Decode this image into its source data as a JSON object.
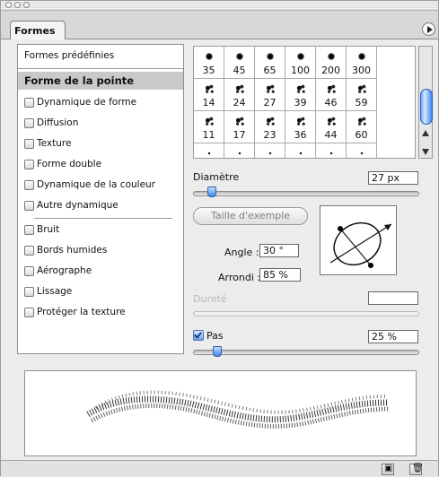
{
  "window": {
    "title": ""
  },
  "tabs": [
    {
      "label": "Formes"
    }
  ],
  "leftPanel": {
    "presets": "Formes prédéfinies",
    "header": "Forme de la pointe",
    "items": [
      "Dynamique de forme",
      "Diffusion",
      "Texture",
      "Forme double",
      "Dynamique de la couleur",
      "Autre dynamique",
      "Bruit",
      "Bords humides",
      "Aérographe",
      "Lissage",
      "Protéger la texture"
    ]
  },
  "brushGrid": {
    "rows": [
      [
        "35",
        "45",
        "65",
        "100",
        "200",
        "300"
      ],
      [
        "14",
        "24",
        "27",
        "39",
        "46",
        "59"
      ],
      [
        "11",
        "17",
        "23",
        "36",
        "44",
        "60"
      ]
    ]
  },
  "controls": {
    "diameter_label": "Diamètre",
    "diameter_value": "27 px",
    "diameter_slider": 0.08,
    "sample_button": "Taille d'exemple",
    "angle_label": "Angle :",
    "angle_value": "30 °",
    "roundness_label": "Arrondi :",
    "roundness_value": "85 %",
    "hardness_label": "Dureté",
    "hardness_value": "",
    "spacing_label": "Pas",
    "spacing_value": "25 %",
    "spacing_slider": 0.12
  },
  "colors": {
    "scroll_thumb": "#4b92ff",
    "slider_knob": "#3d87f0"
  },
  "icons": {
    "panel_menu": "menu-arrow-icon",
    "new_brush": "new-brush-icon",
    "delete_brush": "trash-icon"
  }
}
